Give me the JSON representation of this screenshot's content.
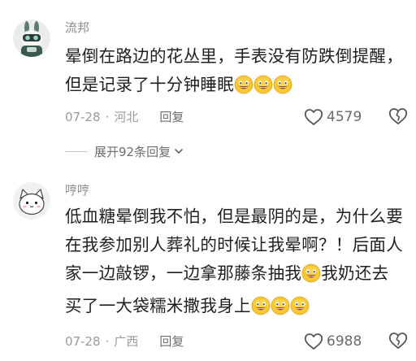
{
  "comments": [
    {
      "username": "流邦",
      "avatar_icon": "bunny-character-icon",
      "text": "晕倒在路边的花丛里，手表没有防跌倒提醒，但是记录了十分钟睡眠",
      "emoji_icon": "smiling-face-emoji-icon",
      "date": "07-28",
      "location": "河北",
      "reply_label": "回复",
      "likes": "4579",
      "expand_label": "展开92条回复"
    },
    {
      "username": "哼哼",
      "avatar_icon": "white-cat-icon",
      "text_1": "低血糖晕倒我不怕，但是最阴的是，为什么要在我参加别人葬礼的时候让我晕啊？！后面人家一边敲锣，一边拿那藤条抽我",
      "text_2": "我奶还去买了一大袋糯米撒我身上",
      "emoji_icon": "smiling-face-emoji-icon",
      "date": "07-28",
      "location": "广西",
      "reply_label": "回复",
      "likes": "6988"
    }
  ],
  "separator": "·",
  "colors": {
    "text": "#1f1f1f",
    "meta": "#9b9b9b",
    "emoji_face": "#f7c531"
  }
}
